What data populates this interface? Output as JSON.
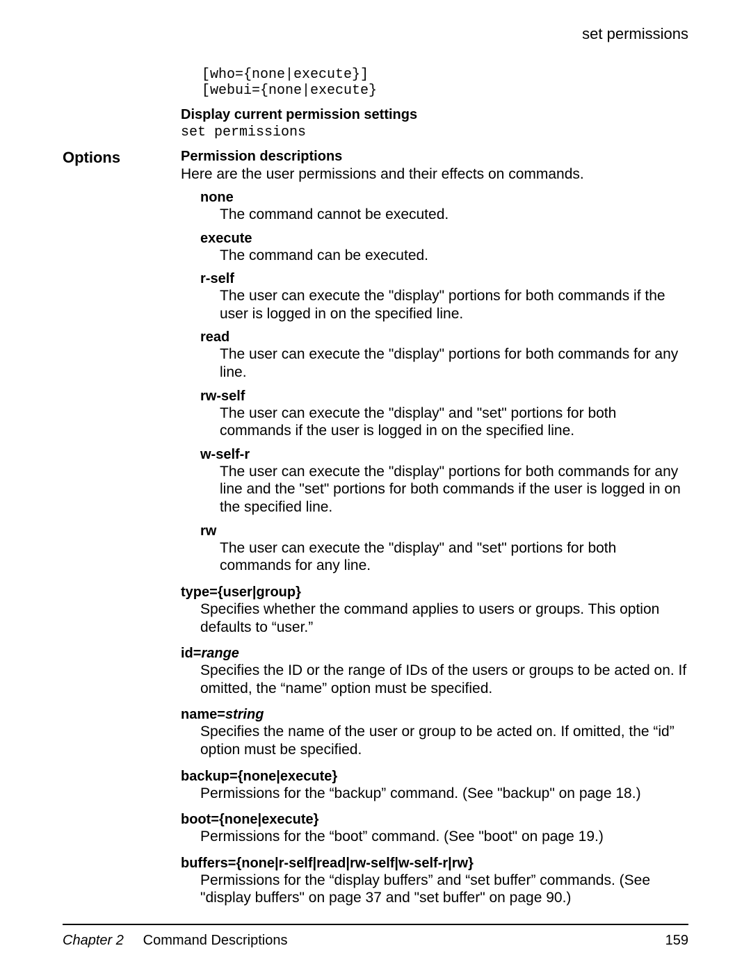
{
  "header": {
    "title": "set permissions"
  },
  "syntax": {
    "lines": "[who={none|execute}]\n[webui={none|execute}"
  },
  "display_section": {
    "heading": "Display current permission settings",
    "command": "set permissions"
  },
  "options_label": "Options",
  "perm_desc": {
    "heading": "Permission descriptions",
    "intro": "Here are the user permissions and their effects on commands.",
    "items": [
      {
        "term": "none",
        "desc": "The command cannot be executed."
      },
      {
        "term": "execute",
        "desc": "The command can be executed."
      },
      {
        "term": "r-self",
        "desc": "The user can execute the \"display\" portions for both commands if the user is logged in on the specified line."
      },
      {
        "term": "read",
        "desc": "The user can execute the \"display\" portions for both commands for any line."
      },
      {
        "term": "rw-self",
        "desc": "The user can execute the \"display\" and \"set\" portions for both commands if the user is logged in on the specified line."
      },
      {
        "term": "w-self-r",
        "desc": "The user can execute the \"display\" portions for both commands for any line and the \"set\" portions for both commands if the user is logged in on the specified line."
      },
      {
        "term": "rw",
        "desc": "The user can execute the \"display\" and \"set\" portions for both commands for any line."
      }
    ]
  },
  "params": [
    {
      "term_prefix": "type=",
      "term_suffix": "{user|group}",
      "suffix_italic": false,
      "desc": "Specifies whether the command applies to users or groups. This option defaults to “user.”"
    },
    {
      "term_prefix": "id=",
      "term_suffix": "range",
      "suffix_italic": true,
      "desc": "Specifies the ID or the range of IDs of the users or groups to be acted on. If omitted, the “name” option must be specified."
    },
    {
      "term_prefix": "name=",
      "term_suffix": "string",
      "suffix_italic": true,
      "desc": "Specifies the name of the user or group to be acted on. If omitted, the “id” option must be specified."
    },
    {
      "term_prefix": "backup=",
      "term_suffix": "{none|execute}",
      "suffix_italic": false,
      "desc": "Permissions for the “backup” command. (See \"backup\" on page 18.)"
    },
    {
      "term_prefix": "boot=",
      "term_suffix": "{none|execute}",
      "suffix_italic": false,
      "desc": "Permissions for the “boot” command. (See \"boot\" on page 19.)"
    },
    {
      "term_prefix": "buffers=",
      "term_suffix": "{none|r-self|read|rw-self|w-self-r|rw}",
      "suffix_italic": false,
      "desc": "Permissions for the “display buffers” and “set buffer” commands. (See \"display buffers\" on page 37 and \"set buffer\" on page 90.)"
    }
  ],
  "footer": {
    "chapter": "Chapter 2",
    "section": "Command Descriptions",
    "page": "159"
  }
}
